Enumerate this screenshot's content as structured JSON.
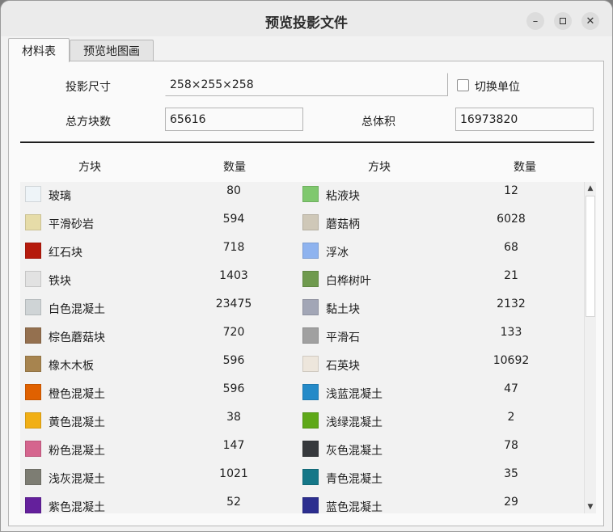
{
  "window": {
    "title": "预览投影文件",
    "minimize_icon": "minimize-icon",
    "maximize_icon": "maximize-icon",
    "close_icon": "close-icon"
  },
  "tabs": [
    {
      "label": "材料表",
      "active": true
    },
    {
      "label": "预览地图画",
      "active": false
    }
  ],
  "info": {
    "size_label": "投影尺寸",
    "size_value": "258×255×258",
    "switch_unit_label": "切换单位",
    "switch_unit_checked": false,
    "total_blocks_label": "总方块数",
    "total_blocks_value": "65616",
    "total_volume_label": "总体积",
    "total_volume_value": "16973820"
  },
  "table": {
    "headers": [
      "方块",
      "数量",
      "方块",
      "数量"
    ],
    "rows": [
      {
        "left": {
          "name": "玻璃",
          "count": "80",
          "color": "#eef4f8"
        },
        "right": {
          "name": "粘液块",
          "count": "12",
          "color": "#7fc86e"
        }
      },
      {
        "left": {
          "name": "平滑砂岩",
          "count": "594",
          "color": "#e6dca8"
        },
        "right": {
          "name": "蘑菇柄",
          "count": "6028",
          "color": "#cfc8b8"
        }
      },
      {
        "left": {
          "name": "红石块",
          "count": "718",
          "color": "#b51a0c"
        },
        "right": {
          "name": "浮冰",
          "count": "68",
          "color": "#8eb3ef"
        }
      },
      {
        "left": {
          "name": "铁块",
          "count": "1403",
          "color": "#e2e2e2"
        },
        "right": {
          "name": "白桦树叶",
          "count": "21",
          "color": "#6f9a4e"
        }
      },
      {
        "left": {
          "name": "白色混凝土",
          "count": "23475",
          "color": "#cfd4d6"
        },
        "right": {
          "name": "黏土块",
          "count": "2132",
          "color": "#a2a6b6"
        }
      },
      {
        "left": {
          "name": "棕色蘑菇块",
          "count": "720",
          "color": "#94704f"
        },
        "right": {
          "name": "平滑石",
          "count": "133",
          "color": "#a0a0a0"
        }
      },
      {
        "left": {
          "name": "橡木木板",
          "count": "596",
          "color": "#a7844f"
        },
        "right": {
          "name": "石英块",
          "count": "10692",
          "color": "#ede6dc"
        }
      },
      {
        "left": {
          "name": "橙色混凝土",
          "count": "596",
          "color": "#e06100"
        },
        "right": {
          "name": "浅蓝混凝土",
          "count": "47",
          "color": "#248ac8"
        }
      },
      {
        "left": {
          "name": "黄色混凝土",
          "count": "38",
          "color": "#f1af15"
        },
        "right": {
          "name": "浅绿混凝土",
          "count": "2",
          "color": "#5ea818"
        }
      },
      {
        "left": {
          "name": "粉色混凝土",
          "count": "147",
          "color": "#d5658e"
        },
        "right": {
          "name": "灰色混凝土",
          "count": "78",
          "color": "#36393d"
        }
      },
      {
        "left": {
          "name": "浅灰混凝土",
          "count": "1021",
          "color": "#7d7d73"
        },
        "right": {
          "name": "青色混凝土",
          "count": "35",
          "color": "#157788"
        }
      },
      {
        "left": {
          "name": "紫色混凝土",
          "count": "52",
          "color": "#64209c"
        },
        "right": {
          "name": "蓝色混凝土",
          "count": "29",
          "color": "#2c2e8f"
        }
      }
    ]
  },
  "scrollbar": {
    "up_icon": "scroll-up-icon",
    "down_icon": "scroll-down-icon"
  }
}
